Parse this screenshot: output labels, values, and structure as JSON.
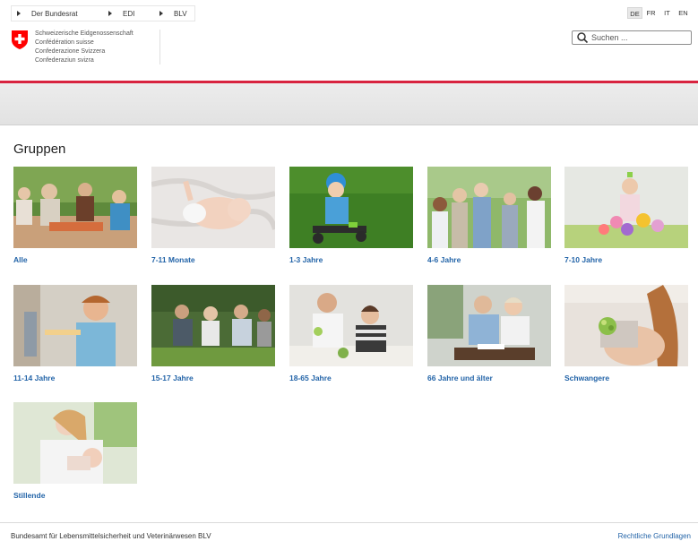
{
  "breadcrumb": [
    {
      "label": "Der Bundesrat"
    },
    {
      "label": "EDI"
    },
    {
      "label": "BLV"
    }
  ],
  "languages": [
    {
      "code": "DE",
      "active": true
    },
    {
      "code": "FR",
      "active": false
    },
    {
      "code": "IT",
      "active": false
    },
    {
      "code": "EN",
      "active": false
    }
  ],
  "logo": {
    "lines": [
      "Schweizerische Eidgenossenschaft",
      "Confédération suisse",
      "Confederazione Svizzera",
      "Confederaziun svizra"
    ],
    "icon": "swiss-shield-icon",
    "colors": {
      "red": "#ff0000",
      "cross": "#ffffff"
    }
  },
  "search": {
    "placeholder": "Suchen ...",
    "value": "",
    "icon": "search-icon"
  },
  "accent_color": "#d8233f",
  "link_color": "#2364a8",
  "main": {
    "title": "Gruppen",
    "groups": [
      {
        "label": "Alle"
      },
      {
        "label": "7-11 Monate"
      },
      {
        "label": "1-3 Jahre"
      },
      {
        "label": "4-6 Jahre"
      },
      {
        "label": "7-10 Jahre"
      },
      {
        "label": "11-14 Jahre"
      },
      {
        "label": "15-17 Jahre"
      },
      {
        "label": "18-65 Jahre"
      },
      {
        "label": "66 Jahre und älter"
      },
      {
        "label": "Schwangere"
      },
      {
        "label": "Stillende"
      }
    ]
  },
  "footer": {
    "left_text": "Bundesamt für Lebensmittelsicherheit und Veterinärwesen BLV",
    "right_link": "Rechtliche Grundlagen"
  }
}
